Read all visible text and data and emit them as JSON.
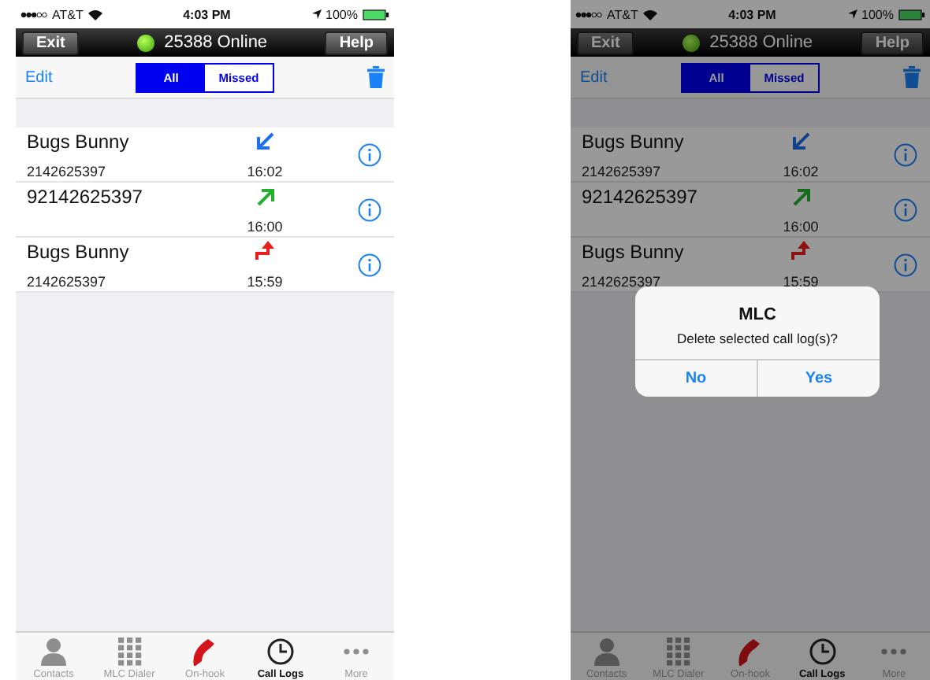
{
  "screens": [
    {
      "status_bar": {
        "carrier": "AT&T",
        "time": "4:03 PM",
        "battery": "100%"
      },
      "title_bar": {
        "left_button": "Exit",
        "status": "25388 Online",
        "right_button": "Help"
      },
      "toolbar": {
        "edit": "Edit",
        "segments": [
          {
            "label": "All",
            "selected": true
          },
          {
            "label": "Missed",
            "selected": false
          }
        ]
      },
      "calls": [
        {
          "name": "Bugs Bunny",
          "number": "2142625397",
          "kind": "incoming",
          "time": "16:02"
        },
        {
          "name": "92142625397",
          "kind": "outgoing",
          "time": "16:00"
        },
        {
          "name": "Bugs Bunny",
          "number": "2142625397",
          "kind": "failed",
          "time": "15:59"
        }
      ],
      "tabs": [
        {
          "label": "Contacts",
          "kind": "contacts",
          "selected": false
        },
        {
          "label": "MLC Dialer",
          "kind": "dialer",
          "selected": false
        },
        {
          "label": "On-hook",
          "kind": "onhook",
          "selected": false
        },
        {
          "label": "Call Logs",
          "kind": "logs",
          "selected": true
        },
        {
          "label": "More",
          "kind": "more",
          "selected": false
        }
      ],
      "dimmed": false
    },
    {
      "status_bar": {
        "carrier": "AT&T",
        "time": "4:03 PM",
        "battery": "100%"
      },
      "title_bar": {
        "left_button": "Exit",
        "status": "25388 Online",
        "right_button": "Help"
      },
      "toolbar": {
        "edit": "Edit",
        "segments": [
          {
            "label": "All",
            "selected": true
          },
          {
            "label": "Missed",
            "selected": false
          }
        ]
      },
      "calls": [
        {
          "name": "Bugs Bunny",
          "number": "2142625397",
          "kind": "incoming",
          "time": "16:02"
        },
        {
          "name": "92142625397",
          "kind": "outgoing",
          "time": "16:00"
        },
        {
          "name": "Bugs Bunny",
          "number": "2142625397",
          "kind": "failed",
          "time": "15:59"
        }
      ],
      "tabs": [
        {
          "label": "Contacts",
          "kind": "contacts",
          "selected": false
        },
        {
          "label": "MLC Dialer",
          "kind": "dialer",
          "selected": false
        },
        {
          "label": "On-hook",
          "kind": "onhook",
          "selected": false
        },
        {
          "label": "Call Logs",
          "kind": "logs",
          "selected": true
        },
        {
          "label": "More",
          "kind": "more",
          "selected": false
        }
      ],
      "dimmed": true,
      "dialog": {
        "title": "MLC",
        "message": "Delete selected call log(s)?",
        "buttons": [
          "No",
          "Yes"
        ]
      }
    }
  ]
}
